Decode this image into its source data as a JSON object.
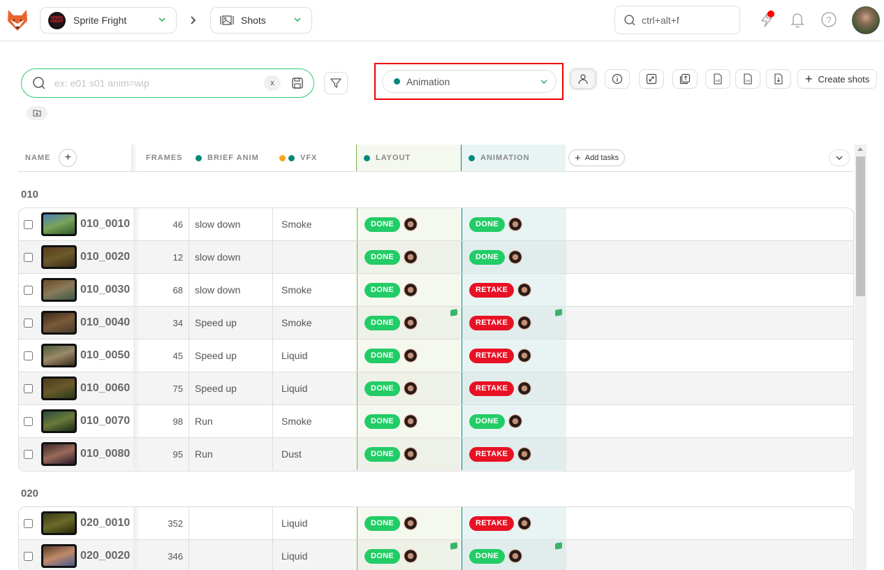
{
  "topbar": {
    "production": "Sprite Fright",
    "production_logo_text": "SPRITE FRIGHT",
    "section": "Shots",
    "global_search_value": "ctrl+alt+f",
    "icons": [
      "lightning-icon",
      "bell-icon",
      "help-icon"
    ],
    "has_notification": true
  },
  "filters": {
    "search_placeholder": "ex: e01 s01 anim=wip",
    "search_value": "",
    "clear_label": "x",
    "task_type": "Animation",
    "task_type_color": "#00897b",
    "create_label": "Create shots"
  },
  "table": {
    "headers": {
      "name": "NAME",
      "frames": "FRAMES",
      "brief": "BRIEF ANIM",
      "vfx": "VFX",
      "layout": "LAYOUT",
      "animation": "ANIMATION",
      "add_tasks": "Add tasks"
    },
    "header_colors": {
      "brief": "#00897b",
      "vfx_1": "#f5a623",
      "vfx_2": "#00897b",
      "layout": "#00897b",
      "animation": "#00897b"
    },
    "sequences": [
      {
        "name": "010",
        "shots": [
          {
            "name": "010_0010",
            "frames": "46",
            "brief": "slow down",
            "vfx": "Smoke",
            "layout": "DONE",
            "animation": "DONE",
            "gem": false
          },
          {
            "name": "010_0020",
            "frames": "12",
            "brief": "slow down",
            "vfx": "",
            "layout": "DONE",
            "animation": "DONE",
            "gem": false
          },
          {
            "name": "010_0030",
            "frames": "68",
            "brief": "slow down",
            "vfx": "Smoke",
            "layout": "DONE",
            "animation": "RETAKE",
            "gem": false
          },
          {
            "name": "010_0040",
            "frames": "34",
            "brief": "Speed up",
            "vfx": "Smoke",
            "layout": "DONE",
            "animation": "RETAKE",
            "gem": true
          },
          {
            "name": "010_0050",
            "frames": "45",
            "brief": "Speed up",
            "vfx": "Liquid",
            "layout": "DONE",
            "animation": "RETAKE",
            "gem": false
          },
          {
            "name": "010_0060",
            "frames": "75",
            "brief": "Speed up",
            "vfx": "Liquid",
            "layout": "DONE",
            "animation": "RETAKE",
            "gem": false
          },
          {
            "name": "010_0070",
            "frames": "98",
            "brief": "Run",
            "vfx": "Smoke",
            "layout": "DONE",
            "animation": "DONE",
            "gem": false
          },
          {
            "name": "010_0080",
            "frames": "95",
            "brief": "Run",
            "vfx": "Dust",
            "layout": "DONE",
            "animation": "RETAKE",
            "gem": false
          }
        ]
      },
      {
        "name": "020",
        "shots": [
          {
            "name": "020_0010",
            "frames": "352",
            "brief": "",
            "vfx": "Liquid",
            "layout": "DONE",
            "animation": "RETAKE",
            "gem": false
          },
          {
            "name": "020_0020",
            "frames": "346",
            "brief": "",
            "vfx": "Liquid",
            "layout": "DONE",
            "animation": "DONE",
            "gem": true
          }
        ]
      }
    ]
  },
  "status_colors": {
    "DONE": "#22cc66",
    "RETAKE": "#e81123"
  },
  "thumb_palettes": [
    [
      "#4a7fb5",
      "#7aa35a",
      "#2f5a2a"
    ],
    [
      "#5a3a1e",
      "#6b5a2a",
      "#3a2a14"
    ],
    [
      "#6a4a2a",
      "#8a7a5a",
      "#3a5a4a"
    ],
    [
      "#3a2a1a",
      "#7a5a3a",
      "#4a3a2a"
    ],
    [
      "#4a5a3a",
      "#9a8a6a",
      "#3a2a1a"
    ],
    [
      "#4a3a1a",
      "#6a5a2a",
      "#2a3a1a"
    ],
    [
      "#2a4a3a",
      "#6a7a3a",
      "#1a2a1a"
    ],
    [
      "#3a2a2a",
      "#9a6a5a",
      "#2a1a2a"
    ],
    [
      "#3a3a1a",
      "#6a6a2a",
      "#2a2a0a"
    ],
    [
      "#5a3a2a",
      "#c08a6a",
      "#4a5a8a"
    ]
  ]
}
